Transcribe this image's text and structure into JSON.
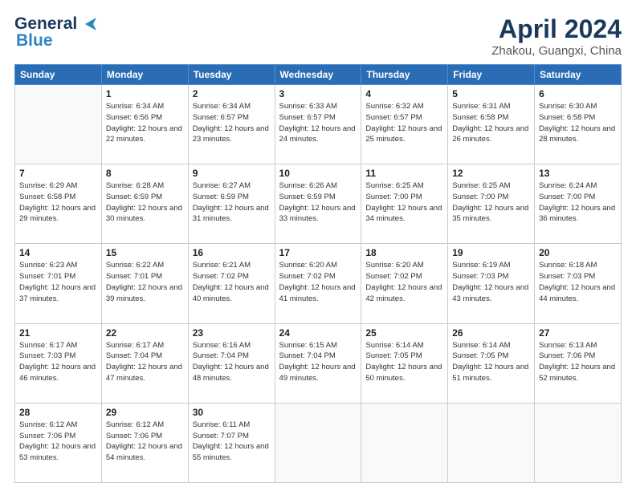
{
  "header": {
    "logo_line1": "General",
    "logo_line2": "Blue",
    "month_year": "April 2024",
    "location": "Zhakou, Guangxi, China"
  },
  "weekdays": [
    "Sunday",
    "Monday",
    "Tuesday",
    "Wednesday",
    "Thursday",
    "Friday",
    "Saturday"
  ],
  "weeks": [
    [
      {
        "day": "",
        "info": ""
      },
      {
        "day": "1",
        "info": "Sunrise: 6:34 AM\nSunset: 6:56 PM\nDaylight: 12 hours\nand 22 minutes."
      },
      {
        "day": "2",
        "info": "Sunrise: 6:34 AM\nSunset: 6:57 PM\nDaylight: 12 hours\nand 23 minutes."
      },
      {
        "day": "3",
        "info": "Sunrise: 6:33 AM\nSunset: 6:57 PM\nDaylight: 12 hours\nand 24 minutes."
      },
      {
        "day": "4",
        "info": "Sunrise: 6:32 AM\nSunset: 6:57 PM\nDaylight: 12 hours\nand 25 minutes."
      },
      {
        "day": "5",
        "info": "Sunrise: 6:31 AM\nSunset: 6:58 PM\nDaylight: 12 hours\nand 26 minutes."
      },
      {
        "day": "6",
        "info": "Sunrise: 6:30 AM\nSunset: 6:58 PM\nDaylight: 12 hours\nand 28 minutes."
      }
    ],
    [
      {
        "day": "7",
        "info": "Sunrise: 6:29 AM\nSunset: 6:58 PM\nDaylight: 12 hours\nand 29 minutes."
      },
      {
        "day": "8",
        "info": "Sunrise: 6:28 AM\nSunset: 6:59 PM\nDaylight: 12 hours\nand 30 minutes."
      },
      {
        "day": "9",
        "info": "Sunrise: 6:27 AM\nSunset: 6:59 PM\nDaylight: 12 hours\nand 31 minutes."
      },
      {
        "day": "10",
        "info": "Sunrise: 6:26 AM\nSunset: 6:59 PM\nDaylight: 12 hours\nand 33 minutes."
      },
      {
        "day": "11",
        "info": "Sunrise: 6:25 AM\nSunset: 7:00 PM\nDaylight: 12 hours\nand 34 minutes."
      },
      {
        "day": "12",
        "info": "Sunrise: 6:25 AM\nSunset: 7:00 PM\nDaylight: 12 hours\nand 35 minutes."
      },
      {
        "day": "13",
        "info": "Sunrise: 6:24 AM\nSunset: 7:00 PM\nDaylight: 12 hours\nand 36 minutes."
      }
    ],
    [
      {
        "day": "14",
        "info": "Sunrise: 6:23 AM\nSunset: 7:01 PM\nDaylight: 12 hours\nand 37 minutes."
      },
      {
        "day": "15",
        "info": "Sunrise: 6:22 AM\nSunset: 7:01 PM\nDaylight: 12 hours\nand 39 minutes."
      },
      {
        "day": "16",
        "info": "Sunrise: 6:21 AM\nSunset: 7:02 PM\nDaylight: 12 hours\nand 40 minutes."
      },
      {
        "day": "17",
        "info": "Sunrise: 6:20 AM\nSunset: 7:02 PM\nDaylight: 12 hours\nand 41 minutes."
      },
      {
        "day": "18",
        "info": "Sunrise: 6:20 AM\nSunset: 7:02 PM\nDaylight: 12 hours\nand 42 minutes."
      },
      {
        "day": "19",
        "info": "Sunrise: 6:19 AM\nSunset: 7:03 PM\nDaylight: 12 hours\nand 43 minutes."
      },
      {
        "day": "20",
        "info": "Sunrise: 6:18 AM\nSunset: 7:03 PM\nDaylight: 12 hours\nand 44 minutes."
      }
    ],
    [
      {
        "day": "21",
        "info": "Sunrise: 6:17 AM\nSunset: 7:03 PM\nDaylight: 12 hours\nand 46 minutes."
      },
      {
        "day": "22",
        "info": "Sunrise: 6:17 AM\nSunset: 7:04 PM\nDaylight: 12 hours\nand 47 minutes."
      },
      {
        "day": "23",
        "info": "Sunrise: 6:16 AM\nSunset: 7:04 PM\nDaylight: 12 hours\nand 48 minutes."
      },
      {
        "day": "24",
        "info": "Sunrise: 6:15 AM\nSunset: 7:04 PM\nDaylight: 12 hours\nand 49 minutes."
      },
      {
        "day": "25",
        "info": "Sunrise: 6:14 AM\nSunset: 7:05 PM\nDaylight: 12 hours\nand 50 minutes."
      },
      {
        "day": "26",
        "info": "Sunrise: 6:14 AM\nSunset: 7:05 PM\nDaylight: 12 hours\nand 51 minutes."
      },
      {
        "day": "27",
        "info": "Sunrise: 6:13 AM\nSunset: 7:06 PM\nDaylight: 12 hours\nand 52 minutes."
      }
    ],
    [
      {
        "day": "28",
        "info": "Sunrise: 6:12 AM\nSunset: 7:06 PM\nDaylight: 12 hours\nand 53 minutes."
      },
      {
        "day": "29",
        "info": "Sunrise: 6:12 AM\nSunset: 7:06 PM\nDaylight: 12 hours\nand 54 minutes."
      },
      {
        "day": "30",
        "info": "Sunrise: 6:11 AM\nSunset: 7:07 PM\nDaylight: 12 hours\nand 55 minutes."
      },
      {
        "day": "",
        "info": ""
      },
      {
        "day": "",
        "info": ""
      },
      {
        "day": "",
        "info": ""
      },
      {
        "day": "",
        "info": ""
      }
    ]
  ]
}
